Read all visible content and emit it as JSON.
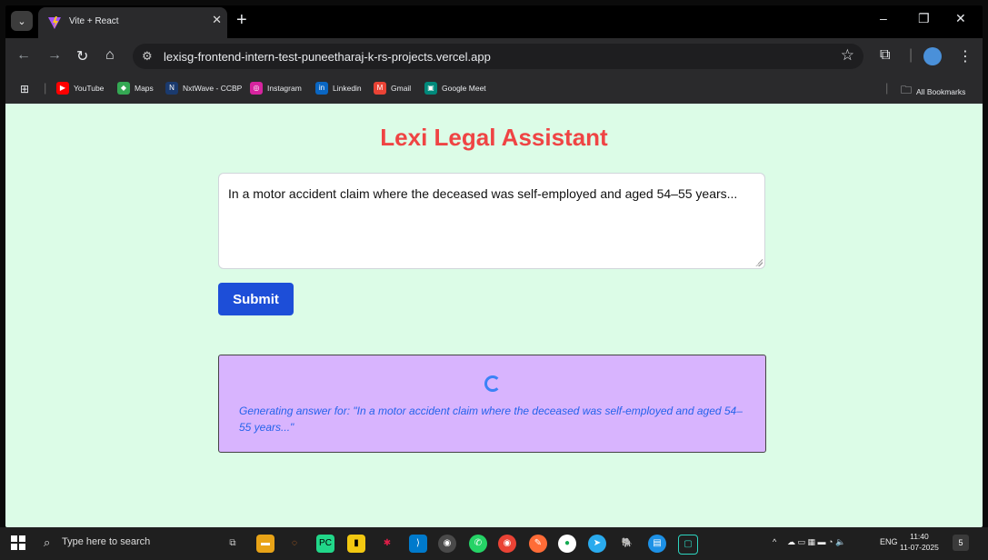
{
  "browser": {
    "tab_title": "Vite + React",
    "tab_close": "✕",
    "new_tab": "+",
    "url": "lexisg-frontend-intern-test-puneetharaj-k-rs-projects.vercel.app",
    "bookmarks": [
      {
        "label": "YouTube",
        "icon": "youtube-icon",
        "color": "#ff0000"
      },
      {
        "label": "Maps",
        "icon": "maps-icon",
        "color": "#34a853"
      },
      {
        "label": "NxtWave - CCBP",
        "icon": "nxtwave-icon",
        "color": "#1a3a6e"
      },
      {
        "label": "Instagram",
        "icon": "instagram-icon",
        "color": "#d6249f"
      },
      {
        "label": "Linkedin",
        "icon": "linkedin-icon",
        "color": "#0a66c2"
      },
      {
        "label": "Gmail",
        "icon": "gmail-icon",
        "color": "#ea4335"
      },
      {
        "label": "Google Meet",
        "icon": "google-meet-icon",
        "color": "#00897b"
      }
    ],
    "all_bookmarks": "All Bookmarks"
  },
  "app": {
    "title": "Lexi Legal Assistant",
    "query": "In a motor accident claim where the deceased was self-employed and aged 54–55 years...",
    "submit_label": "Submit",
    "status": "Generating answer for: \"In a motor accident claim where the deceased was self-employed and aged 54–55 years...\"",
    "colors": {
      "title": "#ef4444",
      "background": "#dcfce7",
      "button": "#1d4ed8",
      "answer_panel": "#d8b4fe",
      "status_text": "#2563eb"
    }
  },
  "taskbar": {
    "search_placeholder": "Type here to search",
    "language": "ENG",
    "time": "11:40",
    "date": "11-07-2025",
    "notification_count": "5"
  }
}
